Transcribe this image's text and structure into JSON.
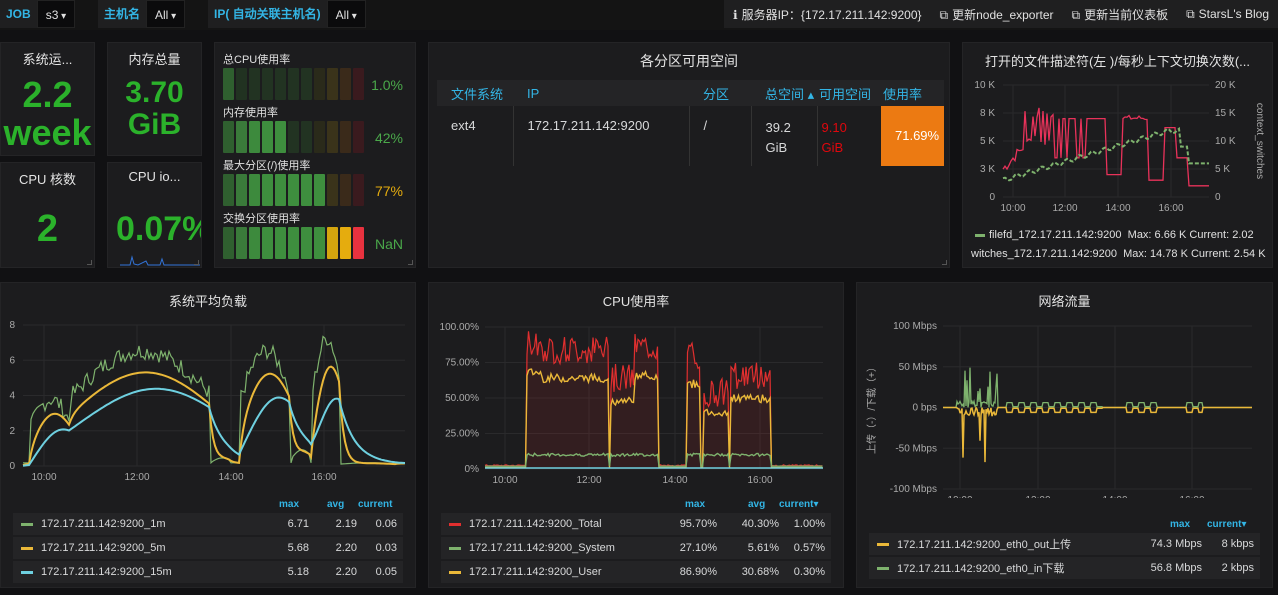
{
  "topbar": {
    "job_label": "JOB",
    "job_value": "s3",
    "host_label": "主机名",
    "host_value": "All",
    "ip_label": "IP( 自动关联主机名)",
    "ip_value": "All",
    "server_ip": "服务器IP：{172.17.211.142:9200}",
    "link_exporter": "更新node_exporter",
    "link_dashboard": "更新当前仪表板",
    "link_blog": "StarsL's Blog"
  },
  "uptime": {
    "title": "系统运...",
    "value_line1": "2.2",
    "value_line2": "week"
  },
  "memtotal": {
    "title": "内存总量",
    "value_line1": "3.70",
    "value_line2": "GiB"
  },
  "cpucores": {
    "title": "CPU 核数",
    "value": "2"
  },
  "cpuio": {
    "title": "CPU io...",
    "value": "0.07%"
  },
  "gauges": [
    {
      "title": "总CPU使用率",
      "value": "1.0%",
      "level": 0.01,
      "color": "#4aa84a"
    },
    {
      "title": "内存使用率",
      "value": "42%",
      "level": 0.42,
      "color": "#4aa84a"
    },
    {
      "title": "最大分区(/)使用率",
      "value": "77%",
      "level": 0.77,
      "color": "#e5ac0e"
    },
    {
      "title": "交换分区使用率",
      "value": "NaN",
      "level": 1.0,
      "color": "#4aa84a"
    }
  ],
  "partition": {
    "title": "各分区可用空间",
    "headers": [
      "文件系统",
      "IP",
      "分区",
      "总空间 ▴",
      "可用空间",
      "使用率"
    ],
    "row": [
      "ext4",
      "172.17.211.142:9200",
      "/",
      "39.2 GiB",
      "9.10 GiB",
      "71.69%"
    ]
  },
  "filefd": {
    "title": "打开的文件描述符(左 )/每秒上下文切换次数(...",
    "yleft": [
      "10 K",
      "8 K",
      "5 K",
      "3 K",
      "0"
    ],
    "yright": [
      "20 K",
      "15 K",
      "10 K",
      "5 K",
      "0"
    ],
    "xticks": [
      "10:00",
      "12:00",
      "14:00",
      "16:00"
    ],
    "yright_label": "context_switches",
    "legend": [
      {
        "name": "filefd_172.17.211.142:9200",
        "stats": "Max: 6.66 K  Current: 2.02",
        "color": "#7eb26d"
      },
      {
        "name": "witches_172.17.211.142:9200",
        "stats": "Max: 14.78 K  Current: 2.54 K",
        "color": "#e24d42"
      }
    ]
  },
  "load": {
    "title": "系统平均负载",
    "yticks": [
      "8",
      "6",
      "4",
      "2",
      "0"
    ],
    "xticks": [
      "10:00",
      "12:00",
      "14:00",
      "16:00"
    ],
    "cols": [
      "max",
      "avg",
      "current"
    ],
    "series": [
      {
        "name": "172.17.211.142:9200_1m",
        "max": "6.71",
        "avg": "2.19",
        "current": "0.06",
        "color": "#7eb26d"
      },
      {
        "name": "172.17.211.142:9200_5m",
        "max": "5.68",
        "avg": "2.20",
        "current": "0.03",
        "color": "#eab839"
      },
      {
        "name": "172.17.211.142:9200_15m",
        "max": "5.18",
        "avg": "2.20",
        "current": "0.05",
        "color": "#6ed0e0"
      }
    ]
  },
  "cpu": {
    "title": "CPU使用率",
    "yticks": [
      "100.00%",
      "75.00%",
      "50.00%",
      "25.00%",
      "0%"
    ],
    "xticks": [
      "10:00",
      "12:00",
      "14:00",
      "16:00"
    ],
    "cols": [
      "max",
      "avg",
      "current▾"
    ],
    "series": [
      {
        "name": "172.17.211.142:9200_Total",
        "max": "95.70%",
        "avg": "40.30%",
        "current": "1.00%",
        "color": "#e02f2f"
      },
      {
        "name": "172.17.211.142:9200_System",
        "max": "27.10%",
        "avg": "5.61%",
        "current": "0.57%",
        "color": "#7eb26d"
      },
      {
        "name": "172.17.211.142:9200_User",
        "max": "86.90%",
        "avg": "30.68%",
        "current": "0.30%",
        "color": "#eab839"
      }
    ]
  },
  "net": {
    "title": "网络流量",
    "yticks": [
      "100 Mbps",
      "50 Mbps",
      "0 bps",
      "-50 Mbps",
      "-100 Mbps"
    ],
    "xticks": [
      "10:00",
      "12:00",
      "14:00",
      "16:00"
    ],
    "ylabel": "上传（-）/下载（+）",
    "cols": [
      "max",
      "current▾"
    ],
    "series": [
      {
        "name": "172.17.211.142:9200_eth0_out上传",
        "max": "74.3 Mbps",
        "current": "8 kbps",
        "color": "#eab839"
      },
      {
        "name": "172.17.211.142:9200_eth0_in下载",
        "max": "56.8 Mbps",
        "current": "2 kbps",
        "color": "#7eb26d"
      }
    ]
  }
}
